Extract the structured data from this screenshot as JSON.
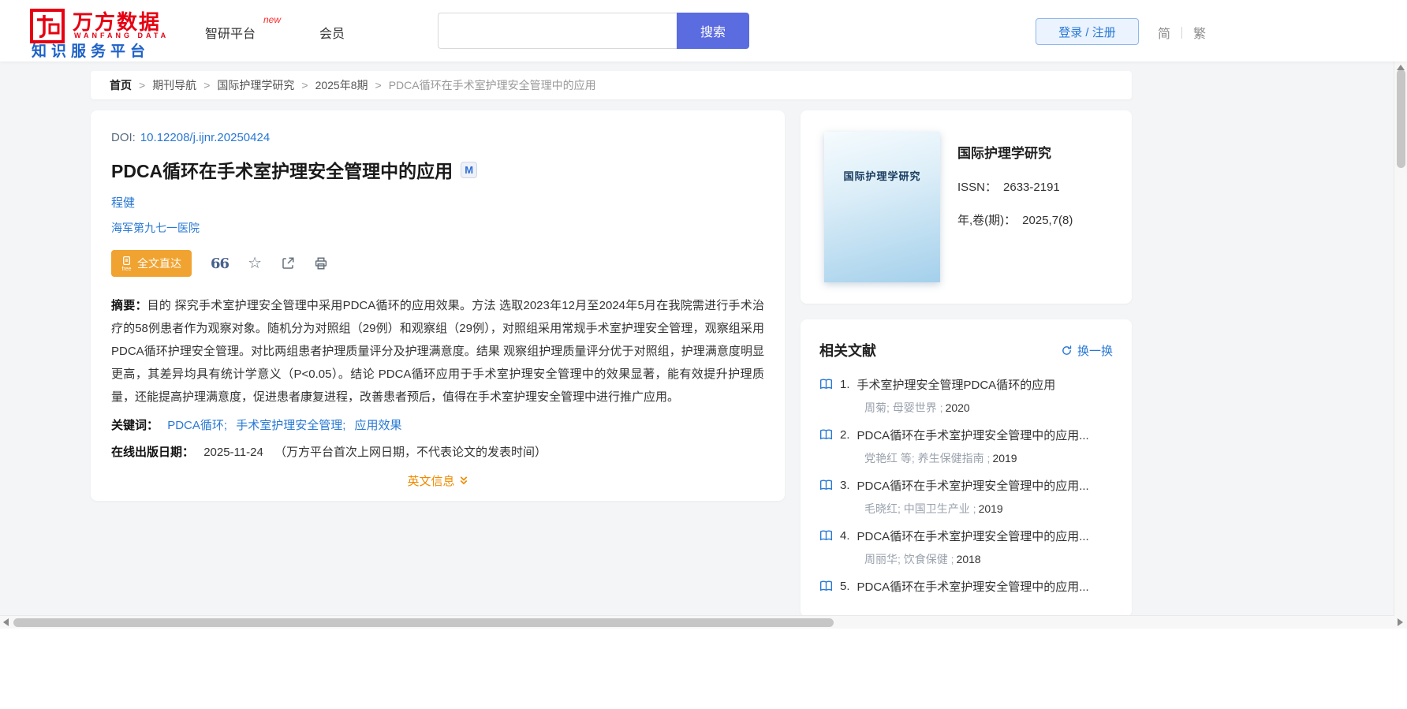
{
  "colors": {
    "brand_red": "#e60012",
    "link_blue": "#2878d5",
    "search_indigo": "#5b6be0",
    "accent_orange": "#f0a330",
    "tagline_blue": "#1e62c8"
  },
  "header": {
    "brand": "万方数据",
    "brand_en": "WANFANG DATA",
    "tagline": "知识服务平台",
    "nav": {
      "zhiyan": "智研平台",
      "zhiyan_badge": "new",
      "member": "会员"
    },
    "search_button": "搜索",
    "login_register": "登录 / 注册",
    "lang_simplified": "简",
    "lang_traditional": "繁"
  },
  "breadcrumb": {
    "separator": ">",
    "items": [
      "首页",
      "期刊导航",
      "国际护理学研究",
      "2025年8期",
      "PDCA循环在手术室护理安全管理中的应用"
    ]
  },
  "article": {
    "doi_label": "DOI:",
    "doi": "10.12208/j.ijnr.20250424",
    "title": "PDCA循环在手术室护理安全管理中的应用",
    "badge": "M",
    "author": "程健",
    "affiliation": "海军第九七一医院",
    "fulltext_button": "全文直达",
    "fulltext_free": "free",
    "quote_icon": "66",
    "star_icon": "☆",
    "abstract_label": "摘要：",
    "abstract": "目的 探究手术室护理安全管理中采用PDCA循环的应用效果。方法 选取2023年12月至2024年5月在我院需进行手术治疗的58例患者作为观察对象。随机分为对照组（29例）和观察组（29例），对照组采用常规手术室护理安全管理，观察组采用PDCA循环护理安全管理。对比两组患者护理质量评分及护理满意度。结果 观察组护理质量评分优于对照组，护理满意度明显更高，其差异均具有统计学意义（P<0.05）。结论 PDCA循环应用于手术室护理安全管理中的效果显著，能有效提升护理质量，还能提高护理满意度，促进患者康复进程，改善患者预后，值得在手术室护理安全管理中进行推广应用。",
    "keywords_label": "关键词：",
    "keywords": [
      "PDCA循环;",
      "手术室护理安全管理;",
      "应用效果"
    ],
    "date_label": "在线出版日期：",
    "date": "2025-11-24",
    "date_note": "（万方平台首次上网日期，不代表论文的发表时间）",
    "english_info": "英文信息"
  },
  "journal": {
    "cover_title": "国际护理学研究",
    "name": "国际护理学研究",
    "issn_label": "ISSN：",
    "issn": "2633-2191",
    "vol_label": "年,卷(期)：",
    "vol": "2025,7(8)"
  },
  "related": {
    "title": "相关文献",
    "refresh": "换一换",
    "items": [
      {
        "no": "1.",
        "title": "手术室护理安全管理PDCA循环的应用",
        "meta": "周菊; 母婴世界 ;",
        "year": "2020"
      },
      {
        "no": "2.",
        "title": "PDCA循环在手术室护理安全管理中的应用...",
        "meta": "党艳红 等; 养生保健指南 ;",
        "year": "2019"
      },
      {
        "no": "3.",
        "title": "PDCA循环在手术室护理安全管理中的应用...",
        "meta": "毛晓红; 中国卫生产业 ;",
        "year": "2019"
      },
      {
        "no": "4.",
        "title": "PDCA循环在手术室护理安全管理中的应用...",
        "meta": "周丽华; 饮食保健 ;",
        "year": "2018"
      },
      {
        "no": "5.",
        "title": "PDCA循环在手术室护理安全管理中的应用...",
        "meta": "",
        "year": ""
      }
    ]
  }
}
